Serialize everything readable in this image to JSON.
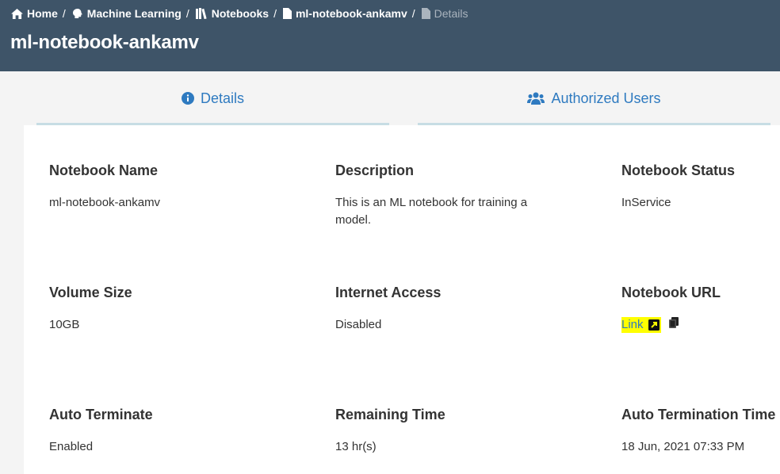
{
  "breadcrumb": {
    "items": [
      {
        "label": "Home",
        "icon": "home-icon"
      },
      {
        "label": "Machine Learning",
        "icon": "brain-icon"
      },
      {
        "label": "Notebooks",
        "icon": "books-icon"
      },
      {
        "label": "ml-notebook-ankamv",
        "icon": "file-icon"
      },
      {
        "label": "Details",
        "icon": "file-icon"
      }
    ],
    "separator": "/"
  },
  "page": {
    "title": "ml-notebook-ankamv"
  },
  "tabs": [
    {
      "label": "Details",
      "icon": "info-circle-icon"
    },
    {
      "label": "Authorized Users",
      "icon": "users-icon"
    }
  ],
  "details": {
    "notebook_name": {
      "label": "Notebook Name",
      "value": "ml-notebook-ankamv"
    },
    "description": {
      "label": "Description",
      "value": "This is an ML notebook for training a model."
    },
    "notebook_status": {
      "label": "Notebook Status",
      "value": "InService"
    },
    "volume_size": {
      "label": "Volume Size",
      "value": "10GB"
    },
    "internet_access": {
      "label": "Internet Access",
      "value": "Disabled"
    },
    "notebook_url": {
      "label": "Notebook URL",
      "link_label": "Link",
      "icons": [
        "external-link-icon",
        "copy-icon"
      ]
    },
    "auto_terminate": {
      "label": "Auto Terminate",
      "value": "Enabled"
    },
    "remaining_time": {
      "label": "Remaining Time",
      "value": "13 hr(s)"
    },
    "auto_termination_time": {
      "label": "Auto Termination Time",
      "value": "18 Jun, 2021 07:33 PM"
    }
  },
  "colors": {
    "header_bg": "#3e5468",
    "accent": "#2e7ac0",
    "highlight": "#ffff00",
    "tab_underline": "#c7dde4"
  }
}
